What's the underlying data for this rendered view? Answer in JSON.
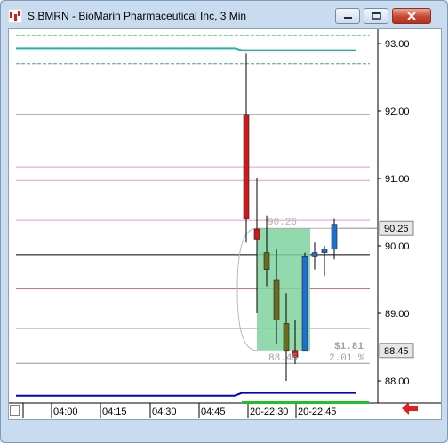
{
  "window": {
    "title": "S.BMRN - BioMarin Pharmaceutical Inc, 3 Min",
    "controls": [
      "minimize",
      "maximize",
      "close"
    ]
  },
  "chart_data": {
    "type": "candlestick",
    "y_axis_ticks": [
      "93.00",
      "92.00",
      "91.00",
      "90.00",
      "89.00",
      "88.00"
    ],
    "x_axis_ticks": [
      "04:00",
      "04:15",
      "04:30",
      "04:45",
      "20-22:30",
      "20-22:45"
    ],
    "ylim": [
      87.7,
      93.15
    ],
    "last_price_label": "90.26",
    "low_price_label": "88.45",
    "annotation_top": "90.26",
    "annotation_bottom": "88.45",
    "change_dollar": "$1.81",
    "change_percent": "2.01 %",
    "candles": [
      {
        "o": 91.95,
        "h": 92.85,
        "l": 90.05,
        "c": 90.4,
        "color": "red"
      },
      {
        "o": 90.25,
        "h": 91.0,
        "l": 89.0,
        "c": 90.1,
        "color": "red"
      },
      {
        "o": 89.9,
        "h": 90.45,
        "l": 89.4,
        "c": 89.65,
        "color": "olive"
      },
      {
        "o": 89.5,
        "h": 89.95,
        "l": 88.55,
        "c": 88.9,
        "color": "olive"
      },
      {
        "o": 88.85,
        "h": 89.3,
        "l": 88.0,
        "c": 88.45,
        "color": "olive"
      },
      {
        "o": 88.45,
        "h": 88.9,
        "l": 88.25,
        "c": 88.35,
        "color": "red"
      },
      {
        "o": 88.45,
        "h": 89.9,
        "l": 88.45,
        "c": 89.85,
        "color": "blue"
      },
      {
        "o": 89.85,
        "h": 90.05,
        "l": 89.65,
        "c": 89.9,
        "color": "blue"
      },
      {
        "o": 89.9,
        "h": 90.0,
        "l": 89.55,
        "c": 89.95,
        "color": "blue"
      },
      {
        "o": 89.95,
        "h": 90.4,
        "l": 89.8,
        "c": 90.32,
        "color": "blue"
      }
    ],
    "levels": [
      {
        "price": 93.12,
        "color": "#3cb371",
        "style": "dashed"
      },
      {
        "price": 92.7,
        "color": "#3cb371",
        "style": "dashed"
      },
      {
        "price": 91.95,
        "color": "#999999",
        "style": "solid"
      },
      {
        "price": 91.17,
        "color": "#e59ad8",
        "style": "solid"
      },
      {
        "price": 90.97,
        "color": "#e59ad8",
        "style": "solid"
      },
      {
        "price": 90.77,
        "color": "#e59ad8",
        "style": "solid"
      },
      {
        "price": 90.38,
        "color": "#e59ad8",
        "style": "solid"
      },
      {
        "price": 89.87,
        "color": "#000000",
        "style": "solid"
      },
      {
        "price": 89.37,
        "color": "#b22222",
        "style": "solid"
      },
      {
        "price": 88.78,
        "color": "#800080",
        "style": "solid"
      },
      {
        "price": 88.26,
        "color": "#999999",
        "style": "solid"
      }
    ],
    "step_lines": [
      {
        "before": 92.93,
        "after": 92.9,
        "color": "#20b2aa"
      },
      {
        "before": 87.78,
        "after": 87.82,
        "color": "#0000cd"
      }
    ]
  }
}
